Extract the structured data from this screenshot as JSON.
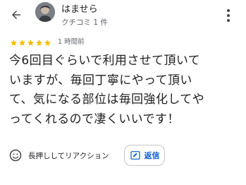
{
  "header": {
    "user_name": "はませら",
    "user_meta": "クチコミ 1 件"
  },
  "rating": {
    "stars": 5,
    "time": "1 時間前",
    "star_color": "#fbbc04"
  },
  "review": {
    "lines": [
      "今6回目ぐらいで利用させて頂いて",
      "いますが、毎回丁寧にやって頂い",
      "て、気になる部位は毎回強化してや",
      "ってくれるので凄くいいです！"
    ]
  },
  "actions": {
    "react_label": "長押ししてリアクション",
    "reply_label": "返信",
    "accent": "#0b57d0"
  }
}
